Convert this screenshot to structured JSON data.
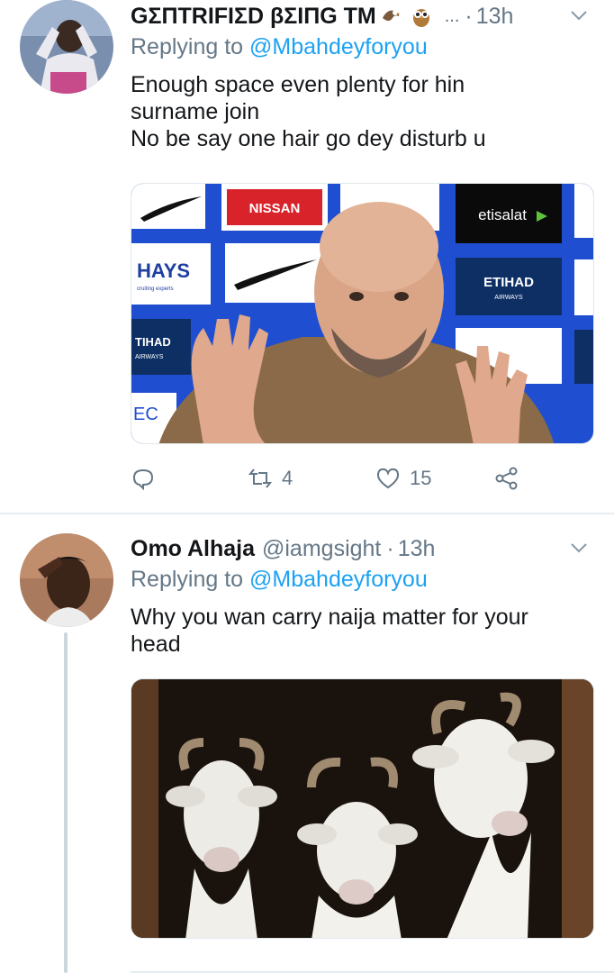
{
  "tweets": [
    {
      "display_name": "GΣΠTRIFIΣD βΣIΠG TM",
      "handle": "",
      "ellipsis": "...",
      "time": "13h",
      "replying_prefix": "Replying to ",
      "replying_to": "@Mbahdeyforyou",
      "text": "Enough space even plenty for hin\nsurname join\nNo be say one hair go dey disturb u",
      "media": "press-conference-photo",
      "icons": [
        "eagle-emoji",
        "owl-emoji",
        "chevron-down-icon"
      ],
      "actions": {
        "reply_count": "",
        "retweet_count": "4",
        "like_count": "15"
      }
    },
    {
      "display_name": "Omo Alhaja",
      "handle": "@iamgsight",
      "time": "13h",
      "replying_prefix": "Replying to ",
      "replying_to": "@Mbahdeyforyou",
      "text": "Why you  wan carry naija matter for your\nhead",
      "media": "three-goats-photo",
      "icons": [
        "chevron-down-icon"
      ]
    }
  ],
  "colors": {
    "text": "#14171a",
    "secondary": "#657786",
    "link": "#1da1f2",
    "divider": "#e6ecf0"
  }
}
